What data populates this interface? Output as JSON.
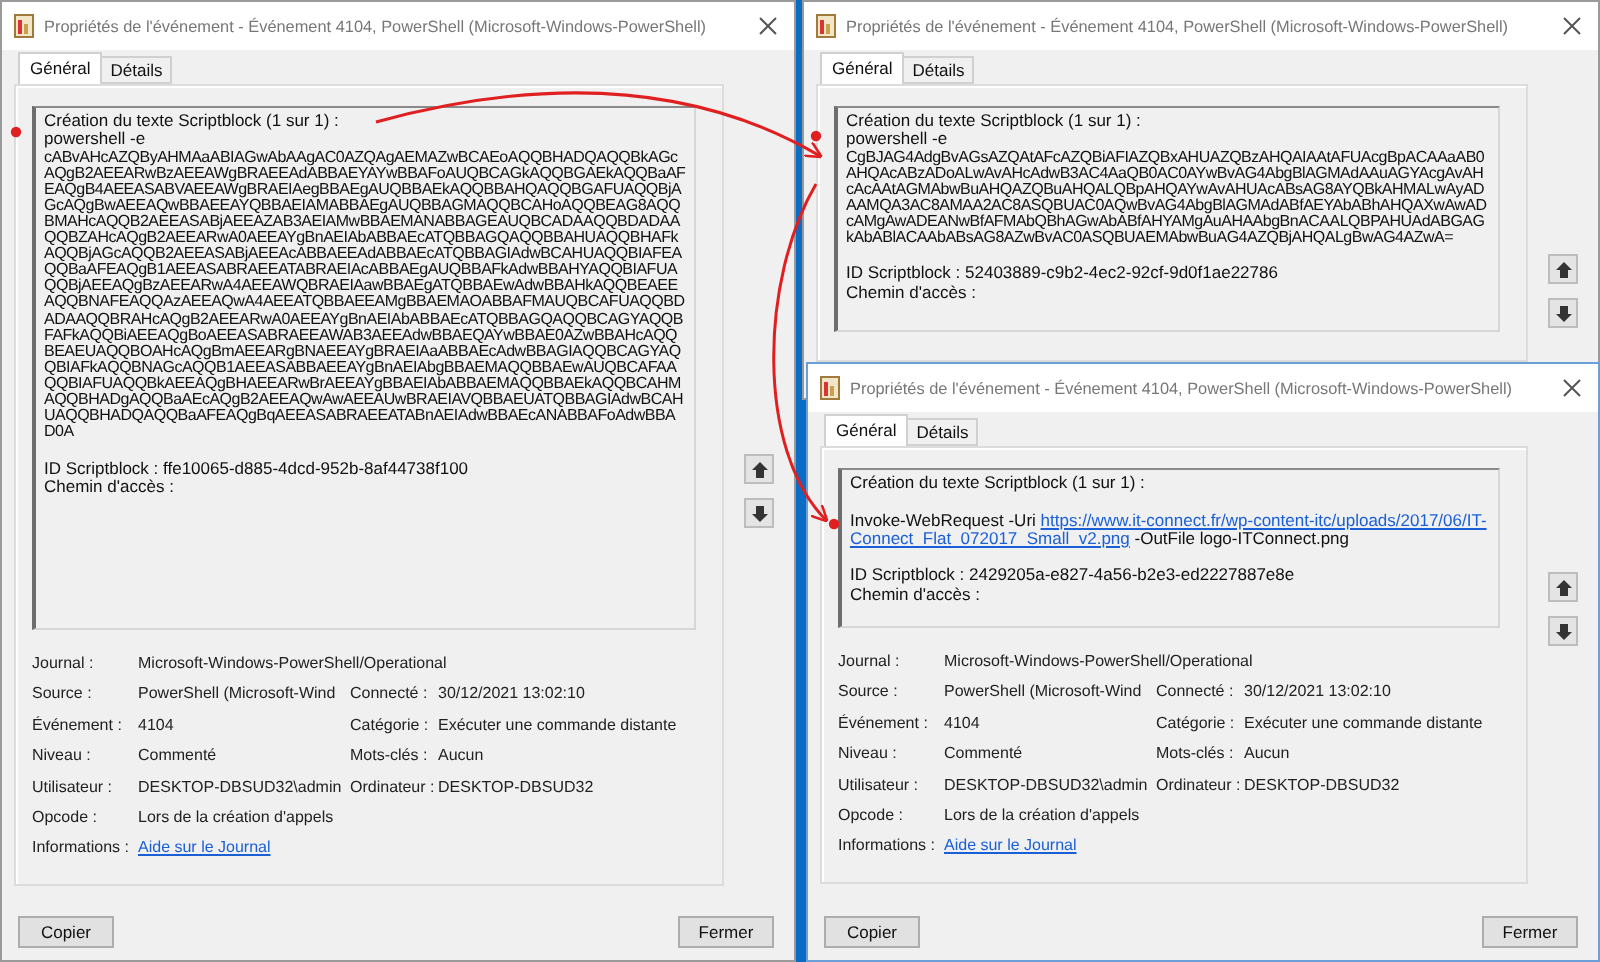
{
  "windows": [
    {
      "title": "Propriétés de l'événement - Événement 4104, PowerShell (Microsoft-Windows-PowerShell)",
      "tabs": [
        {
          "label": "Général",
          "selected": true
        },
        {
          "label": "Détails",
          "selected": false
        }
      ],
      "event_text": {
        "heading": "Création du texte Scriptblock (1 sur 1) :",
        "blank_line_after_heading": false,
        "lines": [
          [
            {
              "kind": "text",
              "text": "powershell -e"
            }
          ],
          [
            {
              "kind": "code",
              "text": "cABvAHcAZQByAHMAaABIAGwAbAAgAC0AZQAgAEMAZwBCAEoAQQBHADQAQQBkAGcAQgB2AEEARwBzAEEAWgBRAEEAdABBAEYAYwBBAFoAUQBCAGkAQQBGAEkAQQBaAFEAQgB4AEEASABVAEEAWgBRAEIAegBBAEgAUQBBAEkAQQBBAHQAQQBGAFUAQQBjAGcAQgBwAEEAQwBBAEEAYQBBAEIAMABBAEgAUQBBAGMAQQBCAHoAQQBEAG8AQQBMAHcAQQB2AEEASABjAEEAZAB3AEIAMwBBAEMANABBAGEAUQBCADAAQQBDADAAQQBZAHcAQgB2AEEARwA0AEEAYgBnAEIAbABBAEcATQBBAGQAQQBBAHUAQQBHAFkAQQBjAGcAQQB2AEEASABjAEEAcABBAEEAdABBAEcATQBBAGIAdwBCAHUAQQBIAFEAQQBaAFEAQgB1AEEASABRAEEATABRAEIAcABBAEgAUQBBAFkAdwBBAHYAQQBIAFUAQQBjAEEAQgBzAEEARwA4AEEAWQBRAEIAawBBAEgATQBBAEwAdwBBAHkAQQBEAEEAQQBNAFEAQQAzAEEAQwA4AEEATQBBAEEAMgBBAEMAOABBAFMAUQBCAFUAQQBDADAAQQBRAHcAQgB2AEEARwA0AEEAYgBnAEIAbABBAEcATQBBAGQAQQBCAGYAQQBFAFkAQQBiAEEAQgBoAEEASABRAEEAWAB3AEEAdwBBAEQAYwBBAE0AZwBBAHcAQQBEAEUAQQBOAHcAQgBmAEEARgBNAEEAYgBRAEIAaABBAEcAdwBBAGIAQQBCAGYAQQBIAFkAQQBNAGcAQQB1AEEASABBAEEAYgBnAEIAbgBBAEMAQQBBAEwAUQBCAFAAQQBIAFUAQQBkAEEAQgBHAEEARwBrAEEAYgBBAEIAbABBAEMAQQBBAEkAQQBCAHMAQQBHADgAQQBaAEcAQgB2AEEAQwAwAEEAUwBRAEIAVQBBAEUATQBBAGIAdwBCAHUAQQBHADQAQQBaAFEAQgBqAEEASABRAEEATABnAEIAdwBBAEcANABBAFoAdwBBAD0A"
            }
          ]
        ],
        "scriptblock_id": "ID Scriptblock : ffe10065-d885-4dcd-952b-8af44738f100",
        "path": "Chemin d'accès :"
      },
      "scroll_buttons": [
        {
          "kind": "up"
        },
        {
          "kind": "down"
        }
      ],
      "details": [
        [
          {
            "kind": "label",
            "text": "Journal :"
          },
          {
            "kind": "value",
            "text": "Microsoft-Windows-PowerShell/Operational"
          }
        ],
        [
          {
            "kind": "label",
            "text": "Source :"
          },
          {
            "kind": "value",
            "text": "PowerShell (Microsoft-Wind"
          },
          {
            "kind": "label",
            "text": "Connecté :"
          },
          {
            "kind": "value",
            "text": "30/12/2021 13:02:10"
          }
        ],
        [
          {
            "kind": "label",
            "text": "Événement :"
          },
          {
            "kind": "value",
            "text": "4104"
          },
          {
            "kind": "label",
            "text": "Catégorie :"
          },
          {
            "kind": "value",
            "text": "Exécuter une commande distante"
          }
        ],
        [
          {
            "kind": "label",
            "text": "Niveau :"
          },
          {
            "kind": "value",
            "text": "Commenté"
          },
          {
            "kind": "label",
            "text": "Mots-clés :"
          },
          {
            "kind": "value",
            "text": "Aucun"
          }
        ],
        [
          {
            "kind": "label",
            "text": "Utilisateur :"
          },
          {
            "kind": "value",
            "text": "DESKTOP-DBSUD32\\admin"
          },
          {
            "kind": "label",
            "text": "Ordinateur :"
          },
          {
            "kind": "value",
            "text": "DESKTOP-DBSUD32"
          }
        ],
        [
          {
            "kind": "label",
            "text": "Opcode :"
          },
          {
            "kind": "value",
            "text": "Lors de la création d'appels"
          }
        ],
        [
          {
            "kind": "label",
            "text": "Informations :"
          },
          {
            "kind": "link",
            "text": "Aide sur le Journal"
          }
        ]
      ],
      "buttons": [
        "Copier",
        "Fermer"
      ]
    },
    {
      "title": "Propriétés de l'événement - Événement 4104, PowerShell (Microsoft-Windows-PowerShell)",
      "tabs": [
        {
          "label": "Général",
          "selected": true
        },
        {
          "label": "Détails",
          "selected": false
        }
      ],
      "event_text": {
        "heading": "Création du texte Scriptblock (1 sur 1) :",
        "blank_line_after_heading": false,
        "lines": [
          [
            {
              "kind": "text",
              "text": "powershell -e"
            }
          ],
          [
            {
              "kind": "code",
              "text": "CgBJAG4AdgBvAGsAZQAtAFcAZQBiAFIAZQBxAHUAZQBzAHQAIAAtAFUAcgBpACAAaAB0AHQAcABzADoALwAvAHcAdwB3AC4AaQB0AC0AYwBvAG4AbgBlAGMAdAAuAGYAcgAvAHcAcAAtAGMAbwBuAHQAZQBuAHQALQBpAHQAYwAvAHUAcABsAG8AYQBkAHMALwAyADAAMQA3AC8AMAA2AC8ASQBUAC0AQwBvAG4AbgBlAGMAdABfAEYAbABhAHQAXwAwADcAMgAwADEANwBfAFMAbQBhAGwAbABfAHYAMgAuAHAAbgBnACAALQBPAHUAdABGAGkAbABlACAAbABsAG8AZwBvAC0ASQBUAEMAbwBuAG4AZQBjAHQALgBwAG4AZwA="
            }
          ]
        ],
        "scriptblock_id": "ID Scriptblock : 52403889-c9b2-4ec2-92cf-9d0f1ae22786",
        "path": "Chemin d'accès :"
      },
      "scroll_buttons": [
        {
          "kind": "up"
        },
        {
          "kind": "down"
        }
      ]
    },
    {
      "title": "Propriétés de l'événement - Événement 4104, PowerShell (Microsoft-Windows-PowerShell)",
      "tabs": [
        {
          "label": "Général",
          "selected": true
        },
        {
          "label": "Détails",
          "selected": false
        }
      ],
      "event_text": {
        "heading": "Création du texte Scriptblock (1 sur 1) :",
        "blank_line_after_heading": true,
        "lines": [
          [
            {
              "kind": "text",
              "text": "Invoke-WebRequest -Uri "
            },
            {
              "kind": "link",
              "text": "https://www.it-connect.fr/wp-content-itc/uploads/2017/06/IT-"
            }
          ],
          [
            {
              "kind": "link",
              "text": "Connect_Flat_072017_Small_v2.png"
            },
            {
              "kind": "text",
              "text": " -OutFile  logo-ITConnect.png"
            }
          ]
        ],
        "scriptblock_id": "ID Scriptblock : 2429205a-e827-4a56-b2e3-ed2227887e8e",
        "path": "Chemin d'accès :"
      },
      "scroll_buttons": [
        {
          "kind": "up"
        },
        {
          "kind": "down"
        }
      ],
      "details": [
        [
          {
            "kind": "label",
            "text": "Journal :"
          },
          {
            "kind": "value",
            "text": "Microsoft-Windows-PowerShell/Operational"
          }
        ],
        [
          {
            "kind": "label",
            "text": "Source :"
          },
          {
            "kind": "value",
            "text": "PowerShell (Microsoft-Wind"
          },
          {
            "kind": "label",
            "text": "Connecté :"
          },
          {
            "kind": "value",
            "text": "30/12/2021 13:02:10"
          }
        ],
        [
          {
            "kind": "label",
            "text": "Événement :"
          },
          {
            "kind": "value",
            "text": "4104"
          },
          {
            "kind": "label",
            "text": "Catégorie :"
          },
          {
            "kind": "value",
            "text": "Exécuter une commande distante"
          }
        ],
        [
          {
            "kind": "label",
            "text": "Niveau :"
          },
          {
            "kind": "value",
            "text": "Commenté"
          },
          {
            "kind": "label",
            "text": "Mots-clés :"
          },
          {
            "kind": "value",
            "text": "Aucun"
          }
        ],
        [
          {
            "kind": "label",
            "text": "Utilisateur :"
          },
          {
            "kind": "value",
            "text": "DESKTOP-DBSUD32\\admin"
          },
          {
            "kind": "label",
            "text": "Ordinateur :"
          },
          {
            "kind": "value",
            "text": "DESKTOP-DBSUD32"
          }
        ],
        [
          {
            "kind": "label",
            "text": "Opcode :"
          },
          {
            "kind": "value",
            "text": "Lors de la création d'appels"
          }
        ],
        [
          {
            "kind": "label",
            "text": "Informations :"
          },
          {
            "kind": "link",
            "text": "Aide sur le Journal"
          }
        ]
      ],
      "buttons": [
        "Copier",
        "Fermer"
      ]
    }
  ]
}
